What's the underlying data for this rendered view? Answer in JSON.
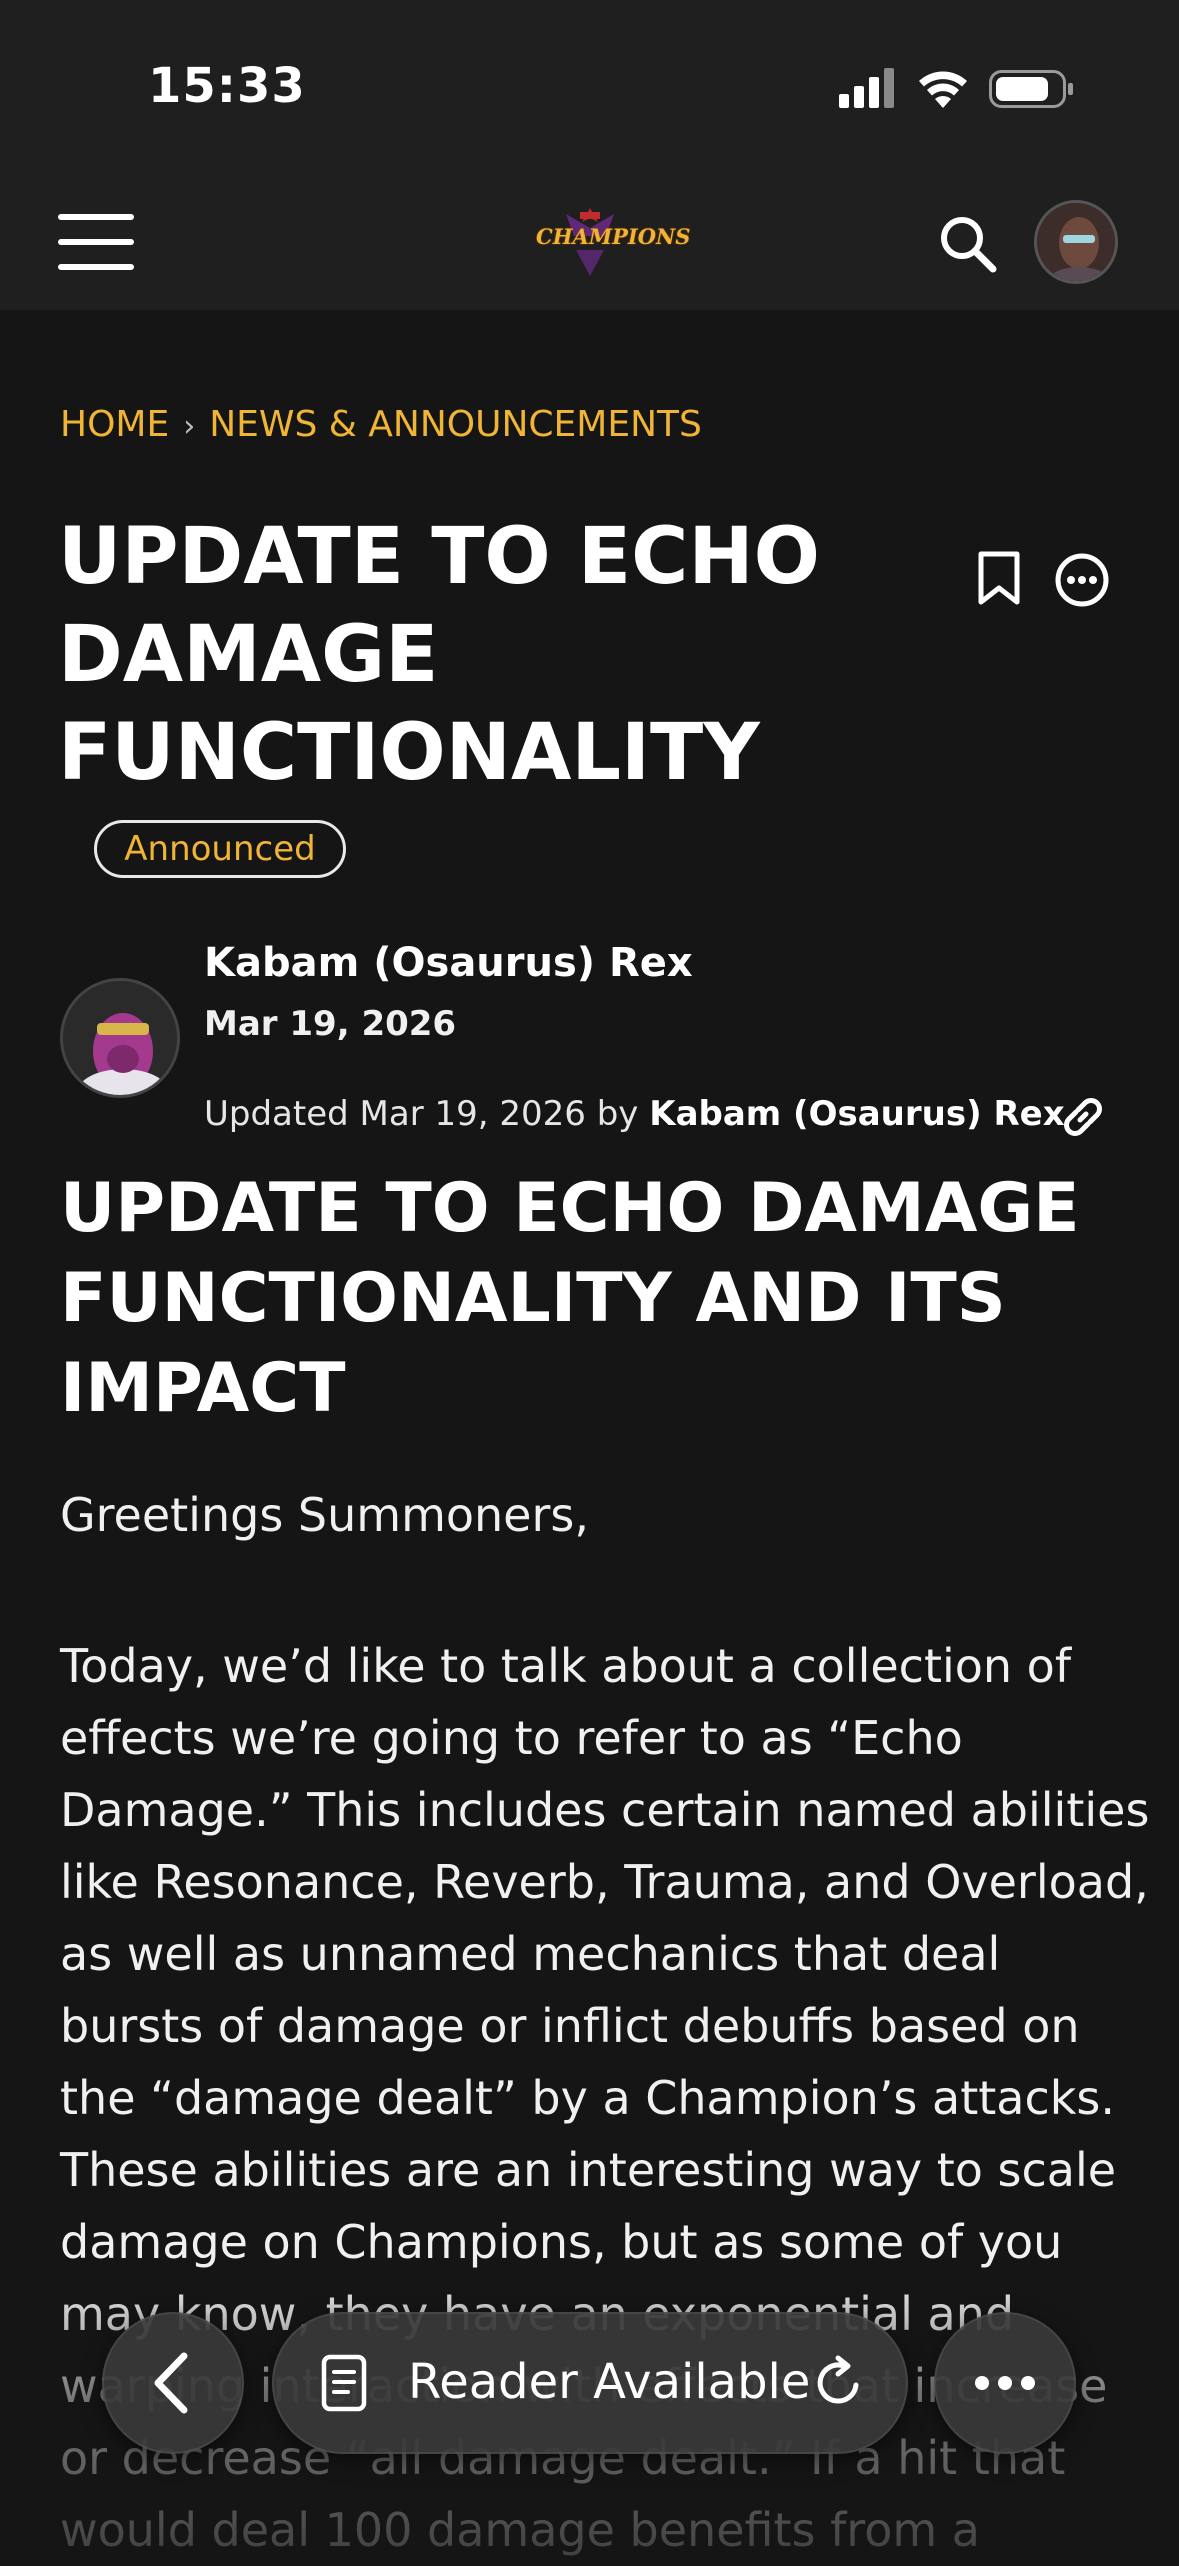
{
  "status_bar": {
    "time": "15:33",
    "icons": [
      "cellular-signal-icon",
      "wifi-icon",
      "battery-icon"
    ]
  },
  "nav": {
    "logo_text": "CHAMPIONS",
    "icons": [
      "hamburger-menu-icon",
      "search-icon",
      "user-avatar"
    ]
  },
  "breadcrumb": {
    "home": "HOME",
    "separator": "›",
    "section": "NEWS & ANNOUNCEMENTS"
  },
  "post": {
    "title": "UPDATE TO ECHO DAMAGE FUNCTIONALITY",
    "badge": "Announced",
    "author": "Kabam (Osaurus) Rex",
    "date": "Mar 19, 2026",
    "updated_prefix": "Updated Mar 19, 2026 by ",
    "updated_by": "Kabam (Osaurus) Rex"
  },
  "article": {
    "heading": "UPDATE TO ECHO DAMAGE FUNCTIONALITY AND ITS IMPACT",
    "greeting": "Greetings Summoners,",
    "paragraph": "Today, we’d like to talk about a collection of effects we’re going to refer to as “Echo Damage.” This includes certain named abilities like Resonance, Reverb, Trauma, and Overload, as well as unnamed mechanics that deal bursts of damage or inflict debuffs based on the “damage dealt” by a Champion’s attacks. These abilities are an interesting way to scale damage on Champions, but as some of you may know, they have an exponential and warping interaction with effects that increase or decrease “all damage dealt.” If a hit that would deal 100 damage benefits from a"
  },
  "browser_toolbar": {
    "reader_label": "Reader Available"
  },
  "colors": {
    "accent": "#f0b535",
    "background": "#151515",
    "header": "#1f1f1f"
  }
}
